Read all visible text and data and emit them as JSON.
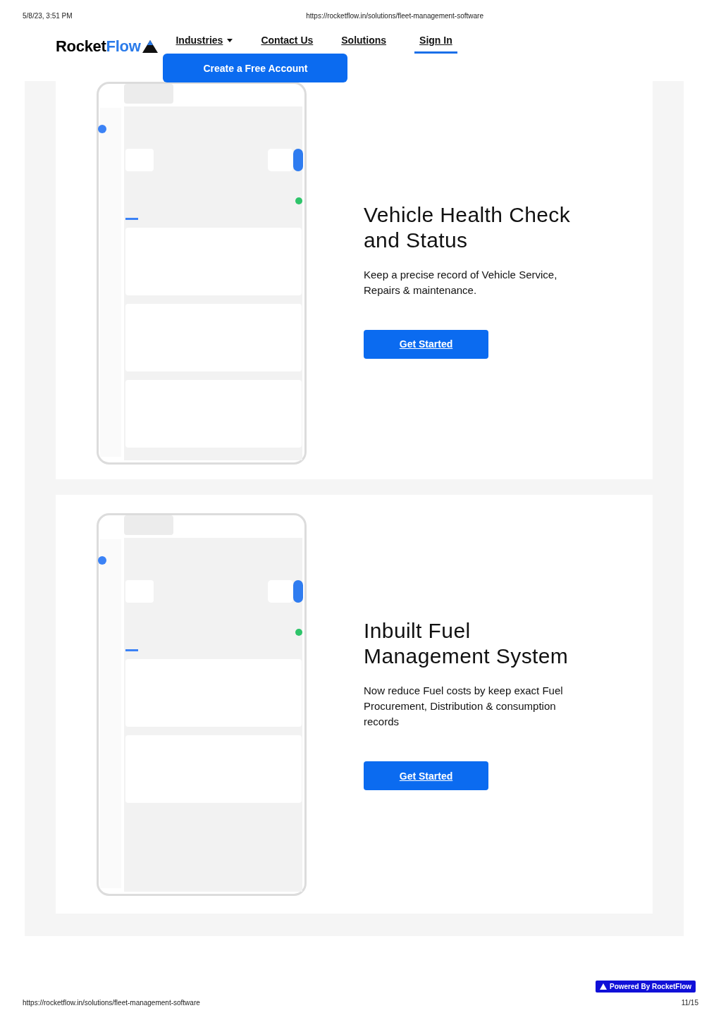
{
  "print_header": {
    "date": "5/8/23, 3:51 PM",
    "url": "https://rocketflow.in/solutions/fleet-management-software"
  },
  "logo": {
    "part_1": "Rocket",
    "part_2": "Flow"
  },
  "nav": [
    {
      "label": "Industries",
      "dropdown": true,
      "selected": false
    },
    {
      "label": "Contact Us",
      "dropdown": false,
      "selected": false
    },
    {
      "label": "Solutions",
      "dropdown": false,
      "selected": false
    },
    {
      "label": "Sign In",
      "dropdown": false,
      "selected": true
    }
  ],
  "cta_button": "Create a Free Account",
  "sections": [
    {
      "title": "Vehicle Health Check and Status",
      "description": "Keep a precise record of Vehicle Service, Repairs & maintenance.",
      "button": "Get Started"
    },
    {
      "title": "Inbuilt Fuel Management System",
      "description": "Now reduce Fuel costs by keep exact Fuel Procurement, Distribution & consumption records",
      "button": "Get Started"
    }
  ],
  "badge": "Powered By RocketFlow",
  "print_footer": {
    "url": "https://rocketflow.in/solutions/fleet-management-software",
    "page": "11/15"
  }
}
